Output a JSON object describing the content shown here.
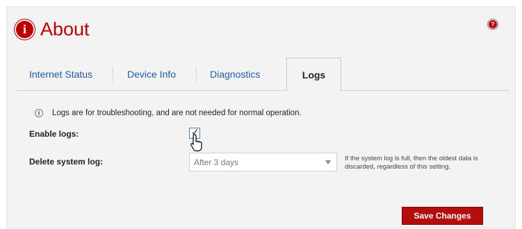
{
  "header": {
    "title": "About",
    "title_icon": "info-icon",
    "help_icon": "help-icon"
  },
  "tabs": [
    {
      "label": "Internet Status",
      "active": false
    },
    {
      "label": "Device Info",
      "active": false
    },
    {
      "label": "Diagnostics",
      "active": false
    },
    {
      "label": "Logs",
      "active": true
    }
  ],
  "info": {
    "icon": "info-icon",
    "text": "Logs are for troubleshooting, and are not needed for normal operation."
  },
  "enable_logs": {
    "label": "Enable logs:",
    "checked": true,
    "cursor_icon": "hand-pointer-icon"
  },
  "delete_log": {
    "label": "Delete system log:",
    "selected": "After 3 days",
    "help_text": "If the system log is full, then the oldest data is discarded, regardless of this setting."
  },
  "actions": {
    "save_label": "Save Changes"
  },
  "colors": {
    "brand_red": "#c00000",
    "tab_link": "#1f5ba8",
    "panel_bg": "#f3f3f3"
  }
}
